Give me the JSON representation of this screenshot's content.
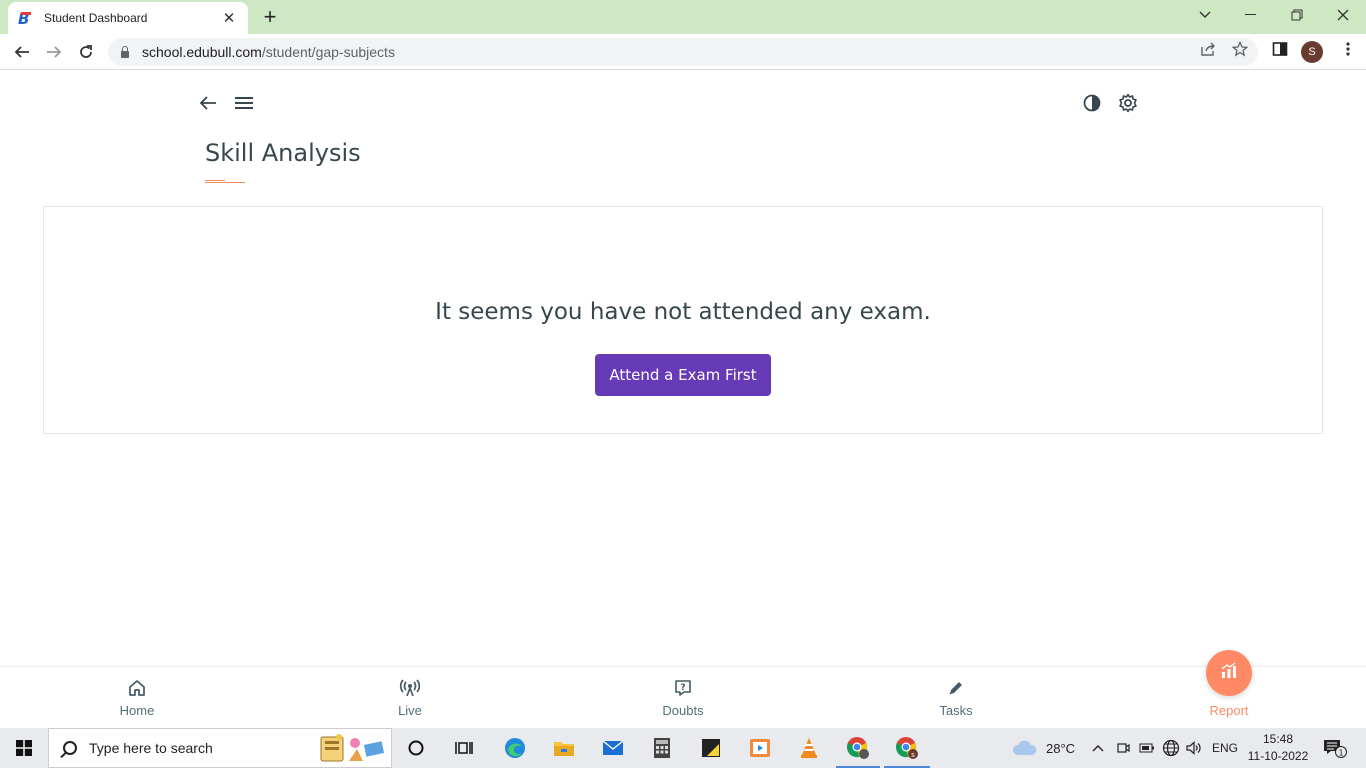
{
  "browser": {
    "tab_title": "Student Dashboard",
    "url_host": "school.edubull.com",
    "url_path": "/student/gap-subjects",
    "profile_initial": "S"
  },
  "page": {
    "title": "Skill Analysis",
    "empty_message": "It seems you have not attended any exam.",
    "cta_label": "Attend a Exam First"
  },
  "bottom_nav": {
    "items": [
      {
        "label": "Home",
        "icon": "home-icon"
      },
      {
        "label": "Live",
        "icon": "live-broadcast-icon"
      },
      {
        "label": "Doubts",
        "icon": "doubt-chat-icon"
      },
      {
        "label": "Tasks",
        "icon": "pencil-icon"
      },
      {
        "label": "Report",
        "icon": "report-chart-icon",
        "active": true
      }
    ]
  },
  "taskbar": {
    "search_placeholder": "Type here to search",
    "weather": "28°C",
    "language": "ENG",
    "time": "15:48",
    "date": "11-10-2022",
    "notification_count": "1"
  },
  "colors": {
    "tab_strip": "#cfe8c4",
    "primary_button": "#673ab7",
    "accent": "#ff8a65",
    "text_dark": "#37474f"
  }
}
